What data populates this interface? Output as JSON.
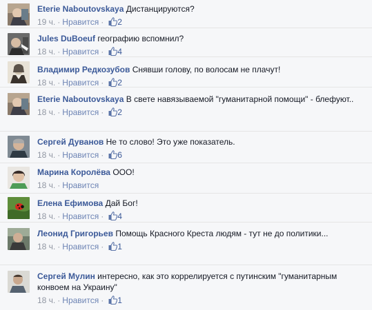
{
  "comments": [
    {
      "author": "Eterie Naboutovskaya",
      "text": "Дистанцируются?",
      "time": "19 ч.",
      "like_label": "Нравится",
      "likes": "2",
      "avatar": "photo-avatar",
      "top": 0
    },
    {
      "author": "Jules DuBoeuf",
      "text": "географию вспомнил?",
      "time": "18 ч.",
      "like_label": "Нравится",
      "likes": "4",
      "avatar": "photo-avatar"
    },
    {
      "author": "Владимир Редкозубов",
      "text": "Снявши голову, по волосам не плачут!",
      "time": "18 ч.",
      "like_label": "Нравится",
      "likes": "2",
      "avatar": "portrait-avatar"
    },
    {
      "author": "Eterie Naboutovskaya",
      "text": "В свете навязываемой \"гуманитарной помощи\" - блефуют..",
      "time": "18 ч.",
      "like_label": "Нравится",
      "likes": "2",
      "avatar": "photo-avatar"
    },
    {
      "author": "Сергей Дуванов",
      "text": "Не то слово! Это уже показатель.",
      "time": "18 ч.",
      "like_label": "Нравится",
      "likes": "6",
      "avatar": "photo-avatar"
    },
    {
      "author": "Марина Королёва",
      "text": "ООО!",
      "time": "18 ч.",
      "like_label": "Нравится",
      "likes": "",
      "avatar": "photo-avatar"
    },
    {
      "author": "Елена Ефимова",
      "text": "Дай Бог!",
      "time": "18 ч.",
      "like_label": "Нравится",
      "likes": "4",
      "avatar": "ladybug-avatar"
    },
    {
      "author": "Леонид Григорьев",
      "text": "Помощь Красного Креста людям - тут не до политики...",
      "time": "18 ч.",
      "like_label": "Нравится",
      "likes": "1",
      "avatar": "photo-avatar"
    },
    {
      "author": "Сергей Мулин",
      "text": "интересно, как это коррелируется с путинским \"гуманитарным конвоем на Украину\"",
      "time": "18 ч.",
      "like_label": "Нравится",
      "likes": "1",
      "avatar": "photo-avatar"
    }
  ]
}
